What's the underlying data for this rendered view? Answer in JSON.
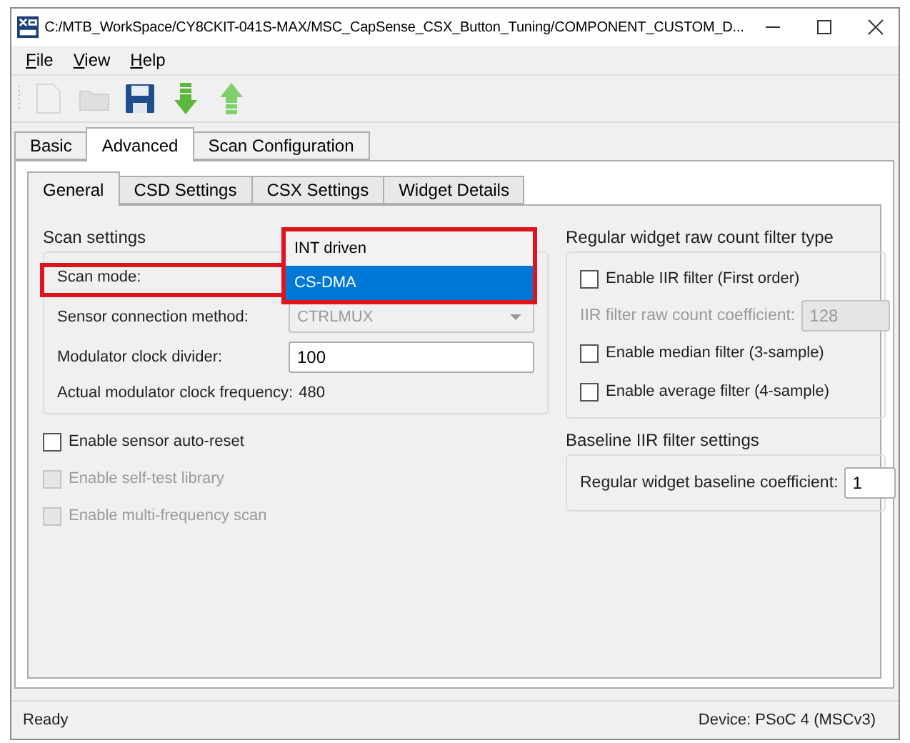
{
  "window": {
    "title": "C:/MTB_WorkSpace/CY8CKIT-041S-MAX/MSC_CapSense_CSX_Button_Tuning/COMPONENT_CUSTOM_D..."
  },
  "menu": [
    {
      "label": "File"
    },
    {
      "label": "View"
    },
    {
      "label": "Help"
    }
  ],
  "toolbar": [
    {
      "kind": "new",
      "disabled": true
    },
    {
      "kind": "open",
      "disabled": true
    },
    {
      "kind": "save",
      "disabled": false
    },
    {
      "kind": "import",
      "disabled": false
    },
    {
      "kind": "export",
      "disabled": false
    }
  ],
  "tabs": [
    {
      "label": "Basic",
      "selected": false
    },
    {
      "label": "Advanced",
      "selected": true
    },
    {
      "label": "Scan Configuration",
      "selected": false
    }
  ],
  "subtabs": [
    {
      "label": "General",
      "selected": true
    },
    {
      "label": "CSD Settings",
      "selected": false
    },
    {
      "label": "CSX Settings",
      "selected": false
    },
    {
      "label": "Widget Details",
      "selected": false
    }
  ],
  "scan_settings": {
    "title": "Scan settings",
    "scan_mode": {
      "label": "Scan mode:",
      "options": [
        {
          "label": "INT driven",
          "selected": false
        },
        {
          "label": "CS-DMA",
          "selected": true
        }
      ]
    },
    "sensor_connection": {
      "label": "Sensor connection method:",
      "value": "CTRLMUX",
      "disabled": true
    },
    "modulator_divider": {
      "label": "Modulator clock divider:",
      "value": "100"
    },
    "actual_frequency": {
      "label": "Actual modulator clock frequency:",
      "value": "480"
    }
  },
  "options": [
    {
      "label": "Enable sensor auto-reset",
      "checked": false,
      "disabled": false
    },
    {
      "label": "Enable self-test library",
      "checked": false,
      "disabled": true
    },
    {
      "label": "Enable multi-frequency scan",
      "checked": false,
      "disabled": true
    }
  ],
  "raw_filter": {
    "title": "Regular widget raw count filter type",
    "items": [
      {
        "kind": "checkbox",
        "label": "Enable IIR filter (First order)",
        "checked": false
      },
      {
        "kind": "field",
        "label": "IIR filter raw count coefficient:",
        "value": "128",
        "disabled": true
      },
      {
        "kind": "checkbox",
        "label": "Enable median filter (3-sample)",
        "checked": false
      },
      {
        "kind": "checkbox",
        "label": "Enable average filter (4-sample)",
        "checked": false
      }
    ]
  },
  "baseline": {
    "title": "Baseline IIR filter settings",
    "label": "Regular widget baseline coefficient:",
    "value": "1"
  },
  "status_bar": {
    "message": "Ready",
    "device": "Device: PSoC 4 (MSCv3)"
  }
}
